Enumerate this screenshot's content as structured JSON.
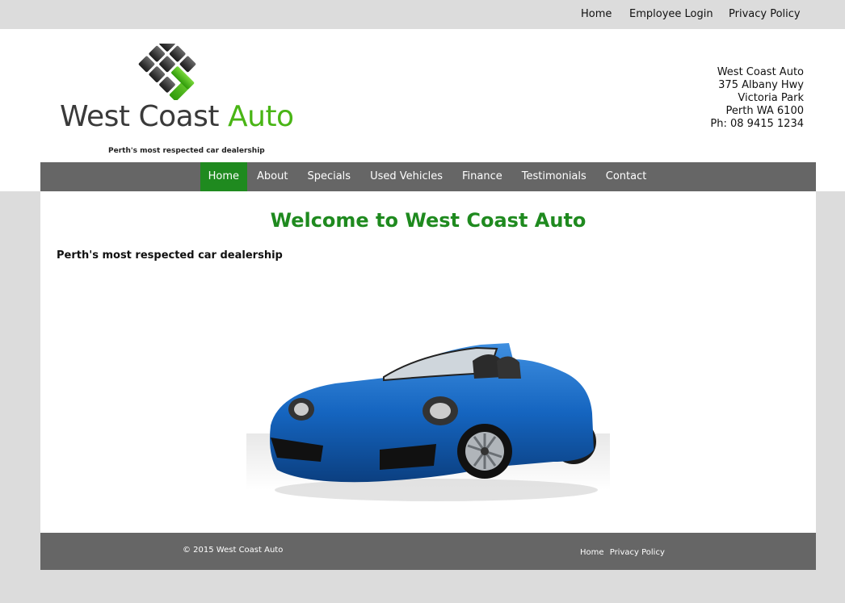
{
  "top_nav": {
    "home": "Home",
    "employee_login": "Employee Login",
    "privacy_policy": "Privacy Policy"
  },
  "logo": {
    "name_part1": "West Coast ",
    "name_part2": "Auto",
    "tagline": "Perth's most respected car dealership",
    "accent_color": "#49b515"
  },
  "address": {
    "line1": "West Coast Auto",
    "line2": "375 Albany Hwy",
    "line3": "Victoria Park",
    "line4": "Perth WA 6100",
    "line5": "Ph: 08 9415 1234"
  },
  "main_nav": {
    "items": [
      "Home",
      "About",
      "Specials",
      "Used Vehicles",
      "Finance",
      "Testimonials",
      "Contact"
    ],
    "active": "Home",
    "active_color": "#1f8a1f"
  },
  "content": {
    "heading": "Welcome to West Coast Auto",
    "subheading": "Perth's most respected car dealership",
    "image": "blue-convertible-car"
  },
  "footer": {
    "copyright": "© 2015 West Coast Auto",
    "link_home": "Home",
    "link_privacy": "Privacy Policy"
  }
}
